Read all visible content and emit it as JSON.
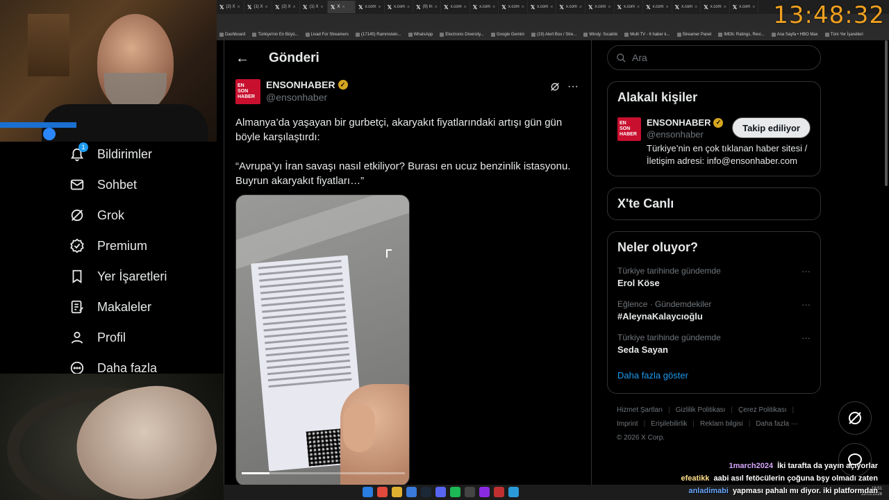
{
  "browser": {
    "tabs": [
      "(2) X",
      "(1) X",
      "(2) X",
      "(1) X",
      "X",
      "x.com",
      "x.com",
      "(9) In",
      "x.com",
      "x.com",
      "x.com",
      "x.com",
      "x.com",
      "x.com",
      "x.com",
      "x.com",
      "x.com",
      "x.com",
      "x.com"
    ],
    "bookmarks": [
      "Dashboard",
      "Türkiye'nin En Büyü...",
      "Livad For Streamers",
      "(17145) Rammstein...",
      "WhatsApp",
      "Electronic Diversity...",
      "Google Gemini",
      "(19) Alert Box / Stre...",
      "Windy: Sıcaklık",
      "Multi TV - 6 haber k...",
      "Streamer Panel",
      "IMDb: Ratings, Revi...",
      "Ana Sayfa • HBO Max",
      "Tüm Yer İşaretleri"
    ],
    "clock": "13:48:32"
  },
  "sidebar": {
    "items": [
      {
        "label": "Bildirimler",
        "icon": "bell-icon",
        "badge": "1"
      },
      {
        "label": "Sohbet",
        "icon": "envelope-icon"
      },
      {
        "label": "Grok",
        "icon": "grok-icon"
      },
      {
        "label": "Premium",
        "icon": "verified-badge-icon"
      },
      {
        "label": "Yer İşaretleri",
        "icon": "bookmark-icon"
      },
      {
        "label": "Makaleler",
        "icon": "article-icon"
      },
      {
        "label": "Profil",
        "icon": "person-icon"
      },
      {
        "label": "Daha fazla",
        "icon": "more-circle-icon"
      }
    ]
  },
  "main": {
    "title": "Gönderi",
    "post": {
      "display_name": "ENSONHABER",
      "handle": "@ensonhaber",
      "logo_text": [
        "EN",
        "SON",
        "HABER"
      ],
      "text": "Almanya’da yaşayan bir gurbetçi, akaryakıt fiyatlarındaki artışı gün gün böyle karşılaştırdı:\n\n“Avrupa’yı İran savaşı nasıl etkiliyor? Burası en ucuz benzinlik istasyonu. Buyrun akaryakıt fiyatları…”",
      "video_progress": 0.17
    }
  },
  "right": {
    "search_placeholder": "Ara",
    "related": {
      "title": "Alakalı kişiler",
      "display_name": "ENSONHABER",
      "handle": "@ensonhaber",
      "bio": "Türkiye’nin en çok tıklanan haber sitesi / İletişim adresi: info@ensonhaber.com",
      "follow_label": "Takip ediliyor"
    },
    "live_title": "X'te Canlı",
    "trends": {
      "title": "Neler oluyor?",
      "items": [
        {
          "context": "Türkiye tarihinde gündemde",
          "name": "Erol Köse"
        },
        {
          "context": "Eğlence · Gündemdekiler",
          "name": "#AleynaKalaycıoğlu"
        },
        {
          "context": "Türkiye tarihinde gündemde",
          "name": "Seda Sayan"
        }
      ],
      "show_more": "Daha fazla göster"
    },
    "footer": [
      "Hizmet Şartları",
      "Gizlilik Politikası",
      "Çerez Politikası",
      "Imprint",
      "Erişilebilirlik",
      "Reklam bilgisi",
      "Daha fazla ···",
      "© 2026 X Corp."
    ]
  },
  "chat": [
    {
      "user": "1march2024",
      "user_color": "#d8a8ff",
      "message": "İki tarafta da yayın açıyorlar"
    },
    {
      "user": "efeatikk",
      "user_color": "#ffe08a",
      "message": "aabi asıl fetöcülerin çoğuna bşy olmadı zaten"
    },
    {
      "user": "anladimabi",
      "user_color": "#6aa8ff",
      "message": "yapması pahalı mı diyor. iki platformdan"
    }
  ],
  "taskbar": {
    "time": "18:51",
    "date": "23.03.2026"
  },
  "colors": {
    "accent": "#1d9bf0",
    "brand_red": "#c8102e",
    "verified_gold": "#d4a520",
    "clock_orange": "#f0a020"
  }
}
